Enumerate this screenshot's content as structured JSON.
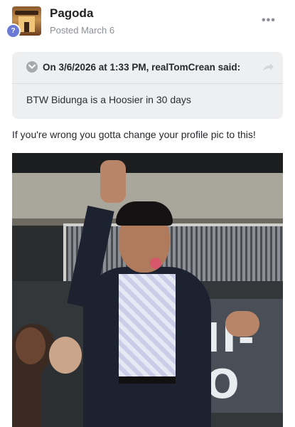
{
  "post": {
    "author": "Pagoda",
    "posted": "Posted March 6",
    "more_icon": "•••",
    "badge": "?"
  },
  "quote": {
    "attribution": "On 3/6/2026 at 1:33 PM, realTomCrean said:",
    "text": "BTW Bidunga is a Hoosier in 30 days"
  },
  "body": {
    "text": "If you're wrong you gotta change your profile pic to this!"
  },
  "photo": {
    "screen_text": "II-O"
  },
  "colors": {
    "quote_bg": "#eeeff1",
    "meta_gray": "#8b8f95",
    "badge": "#6a7ad6"
  }
}
